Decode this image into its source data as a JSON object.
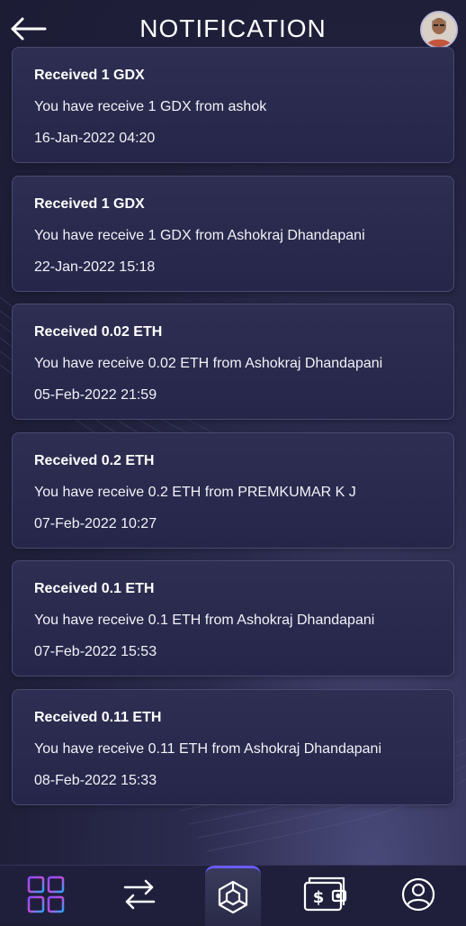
{
  "header": {
    "title": "NOTIFICATION",
    "back_icon": "back-arrow-icon",
    "avatar_icon": "user-avatar"
  },
  "notifications": [
    {
      "title": "Received 1 GDX",
      "message": "You have receive 1 GDX from ashok",
      "time": "16-Jan-2022 04:20"
    },
    {
      "title": "Received 1 GDX",
      "message": "You have receive 1 GDX from Ashokraj Dhandapani",
      "time": "22-Jan-2022 15:18"
    },
    {
      "title": "Received 0.02 ETH",
      "message": "You have receive 0.02 ETH from Ashokraj Dhandapani",
      "time": "05-Feb-2022 21:59"
    },
    {
      "title": "Received 0.2 ETH",
      "message": "You have receive 0.2 ETH from PREMKUMAR K J",
      "time": "07-Feb-2022 10:27"
    },
    {
      "title": "Received 0.1 ETH",
      "message": "You have receive 0.1 ETH from Ashokraj Dhandapani",
      "time": "07-Feb-2022 15:53"
    },
    {
      "title": "Received 0.11 ETH",
      "message": "You have receive 0.11 ETH from Ashokraj Dhandapani",
      "time": "08-Feb-2022 15:33"
    }
  ],
  "bottom_nav": {
    "items": [
      {
        "icon": "dashboard-grid-icon"
      },
      {
        "icon": "transfer-arrows-icon"
      },
      {
        "icon": "hexagon-logo-icon"
      },
      {
        "icon": "wallet-icon"
      },
      {
        "icon": "profile-icon"
      }
    ]
  },
  "colors": {
    "background": "#1f1f3a",
    "card": "#2a2a4e",
    "accent_gradient": [
      "#6a5cff",
      "#c04fd8",
      "#28a6ff"
    ]
  }
}
